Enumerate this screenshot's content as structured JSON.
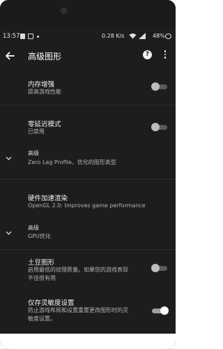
{
  "status": {
    "time": "13:57",
    "speed": "0.28 K/s",
    "battery": "48%"
  },
  "appbar": {
    "title": "高级图形",
    "help_label": "?"
  },
  "items": [
    {
      "title": "内存增强",
      "subtitle": "提高游戏性能",
      "toggle_on": false
    },
    {
      "title": "零延迟模式",
      "subtitle": "已禁用",
      "toggle_on": false
    },
    {
      "header": "高级",
      "subtitle": "Zero Lag Profile、优化的图形类型"
    },
    {
      "title": "硬件加速渲染",
      "subtitle": "OpenGL 2.0: Improves game performance"
    },
    {
      "header": "高级",
      "subtitle": "GPU优化"
    },
    {
      "title": "土豆图形",
      "subtitle_line1": "启用最低的纹理质量。如果您的游戏表现",
      "subtitle_line2": "不佳很有用",
      "toggle_on": false
    },
    {
      "title": "仅存灵敏度设置",
      "subtitle_line1": "防止游戏布局和设置重置更改图形时的灵",
      "subtitle_line2": "敏度设置。",
      "toggle_on": true
    }
  ],
  "icons": {
    "back": "arrow-left-icon",
    "help": "help-circle-icon",
    "more": "more-vert-icon",
    "expand": "chevron-down-icon"
  },
  "colors": {
    "background": "#1d1d1d",
    "text": "#f2f2f2",
    "subtext": "#b3b3b3"
  }
}
